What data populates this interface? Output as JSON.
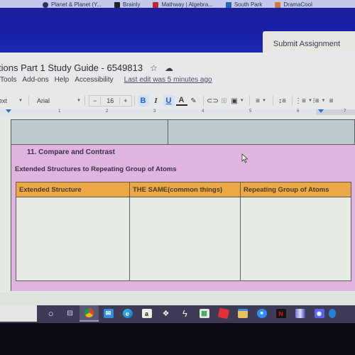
{
  "bookmarks": [
    {
      "label": "Planet & Planet (Y...",
      "icon": "planet-icon",
      "color": "#2b2f5a"
    },
    {
      "label": "Brainly",
      "icon": "brainly-icon",
      "color": "#222"
    },
    {
      "label": "Mathway | Algebra...",
      "icon": "mathway-icon",
      "color": "#c0262d"
    },
    {
      "label": "South Park",
      "icon": "southpark-icon",
      "color": "#2266b0"
    },
    {
      "label": "DramaCool",
      "icon": "dramacool-icon",
      "color": "#d07a3a"
    }
  ],
  "header": {
    "submit_label": "Submit Assignment"
  },
  "doc": {
    "title": "tions Part 1 Study Guide - 6549813",
    "menu": [
      "Tools",
      "Add-ons",
      "Help",
      "Accessibility"
    ],
    "last_edit": "Last edit was 5 minutes ago"
  },
  "toolbar": {
    "style_value": "ext",
    "font_value": "Arial",
    "font_size": "16",
    "minus": "−",
    "plus": "+",
    "bold": "B",
    "italic": "I",
    "underline": "U",
    "text_color": "A"
  },
  "ruler": {
    "labels": [
      "1",
      "2",
      "3",
      "4",
      "5",
      "6",
      "7"
    ]
  },
  "content": {
    "question_title": "11. Compare and Contrast",
    "question_subtitle": "Extended Structures to Repeating Group of Atoms",
    "table": {
      "headers": [
        "Extended Structure",
        "THE SAME(common things)",
        "Repeating Group of Atoms"
      ],
      "rows": [
        [
          "",
          "",
          ""
        ]
      ]
    }
  },
  "colors": {
    "header_blue": "#1921a8",
    "pink_block": "#e1b4df",
    "table_header": "#eba846",
    "blue_row": "#bccad0"
  },
  "taskbar": {
    "icons": [
      {
        "name": "cortana-icon",
        "glyph": "○"
      },
      {
        "name": "task-view-icon",
        "glyph": "⧉"
      },
      {
        "name": "chrome-icon",
        "glyph": "●"
      },
      {
        "name": "mail-icon",
        "glyph": "✉"
      },
      {
        "name": "edge-icon",
        "glyph": "e"
      },
      {
        "name": "amazon-icon",
        "glyph": "a"
      },
      {
        "name": "dropbox-icon",
        "glyph": "❖"
      },
      {
        "name": "lightning-icon",
        "glyph": "ϟ"
      },
      {
        "name": "store-icon",
        "glyph": "▦"
      },
      {
        "name": "roblox-icon",
        "glyph": "◆"
      },
      {
        "name": "file-explorer-icon",
        "glyph": "▭"
      },
      {
        "name": "zoom-icon",
        "glyph": "■"
      },
      {
        "name": "netflix-icon",
        "glyph": "N"
      },
      {
        "name": "app-icon",
        "glyph": "▮"
      },
      {
        "name": "discord-icon",
        "glyph": "◉"
      },
      {
        "name": "edge-beta-icon",
        "glyph": "◐"
      }
    ]
  }
}
